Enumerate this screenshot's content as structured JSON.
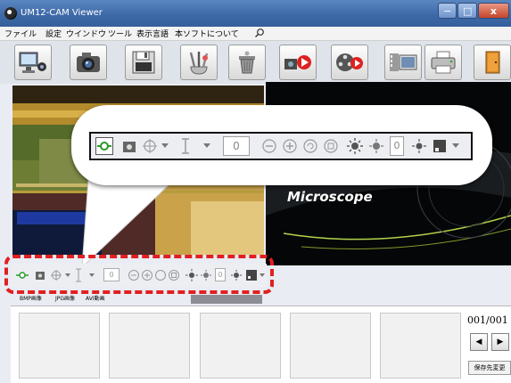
{
  "window": {
    "title": "UM12-CAM Viewer",
    "min": "−",
    "max": "□",
    "close": "x"
  },
  "menu": [
    "ファイル",
    "設定",
    "ウインドウ",
    "ツール",
    "表示言語",
    "本ソフトについて"
  ],
  "toolbar": {
    "icons": [
      "pc-camera-icon",
      "camera-icon",
      "floppy-save-icon",
      "tools-icon",
      "trash-icon",
      "video-capture-icon",
      "film-record-icon",
      "screen-capture-icon",
      "printer-icon",
      "exit-door-icon"
    ]
  },
  "preview": {
    "brand_text": "Microscope"
  },
  "camera_toolbar": {
    "zoom_value": "0",
    "brightness_value": "0"
  },
  "tabs": [
    "BMP画像",
    "JPG画像",
    "AVI動画"
  ],
  "thumbnails": {
    "counter": "001/001",
    "prev": "◀",
    "next": "▶",
    "save_label": "保存先変更"
  },
  "colors": {
    "titlebar": "#3e6aa8",
    "highlight": "#e02020",
    "accent_green": "#2a9a2a"
  }
}
